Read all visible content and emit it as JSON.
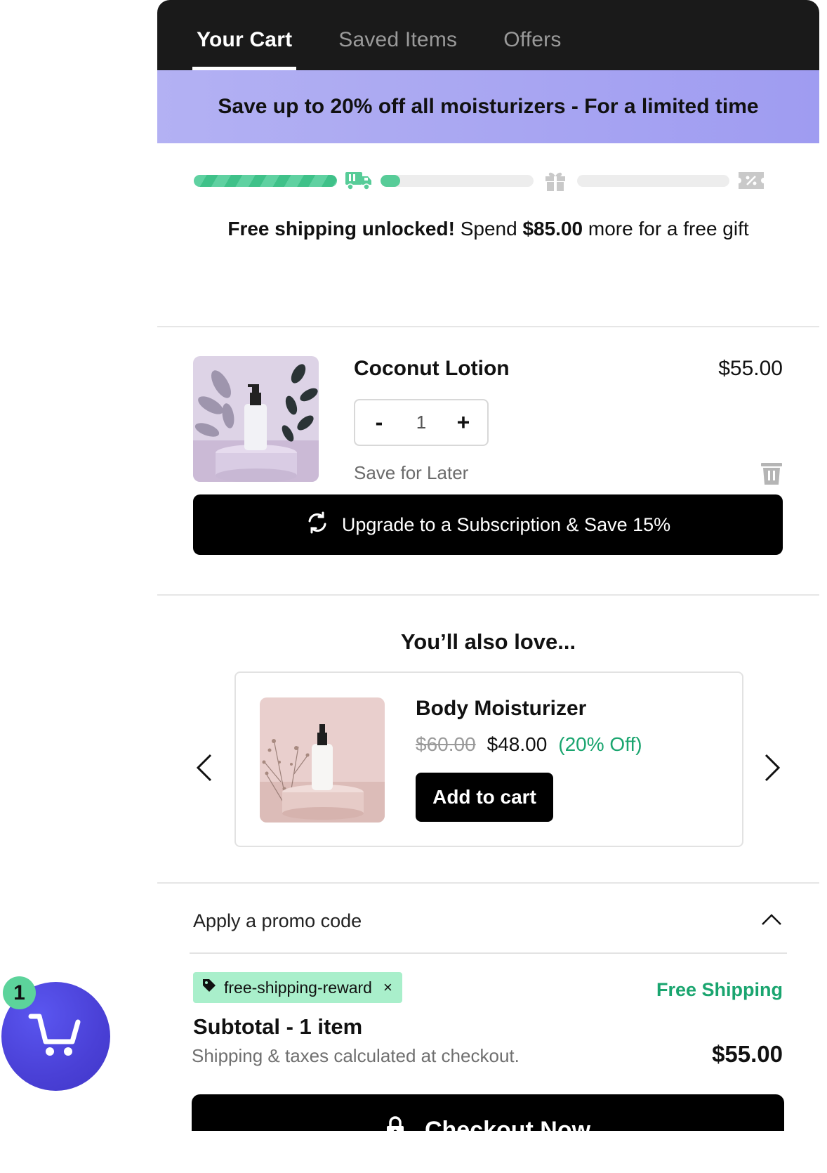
{
  "tabs": [
    {
      "label": "Your Cart",
      "active": true
    },
    {
      "label": "Saved Items",
      "active": false
    },
    {
      "label": "Offers",
      "active": false
    }
  ],
  "banner": {
    "text": "Save up to 20% off all moisturizers - For a limited time"
  },
  "progress": {
    "milestones": [
      "truck-icon",
      "gift-icon",
      "percent-tag-icon"
    ],
    "segment_levels": [
      1.0,
      0.1,
      0.0
    ],
    "message_bold": "Free shipping unlocked!",
    "message_mid": " Spend ",
    "message_amount": "$85.00",
    "message_end": " more for a free gift"
  },
  "cart_item": {
    "name": "Coconut Lotion",
    "price": "$55.00",
    "quantity": "1",
    "minus": "-",
    "plus": "+",
    "save_later": "Save for Later",
    "upgrade_label": "Upgrade to a Subscription & Save 15%"
  },
  "recommendations": {
    "title": "You’ll also love...",
    "product": {
      "name": "Body Moisturizer",
      "old_price": "$60.00",
      "price": "$48.00",
      "discount": "(20% Off)",
      "add_label": "Add to cart"
    }
  },
  "promo": {
    "label": "Apply a promo code",
    "applied_code": "free-shipping-reward",
    "remove": "×",
    "benefit": "Free Shipping"
  },
  "totals": {
    "subtotal_label": "Subtotal - 1 item",
    "note": "Shipping & taxes calculated at checkout.",
    "total": "$55.00",
    "checkout_label": "Checkout Now"
  },
  "floating_cart": {
    "count": "1"
  },
  "colors": {
    "accent_green": "#1aa56f",
    "banner": "#a9a6f2",
    "fab": "#4a40d6"
  }
}
